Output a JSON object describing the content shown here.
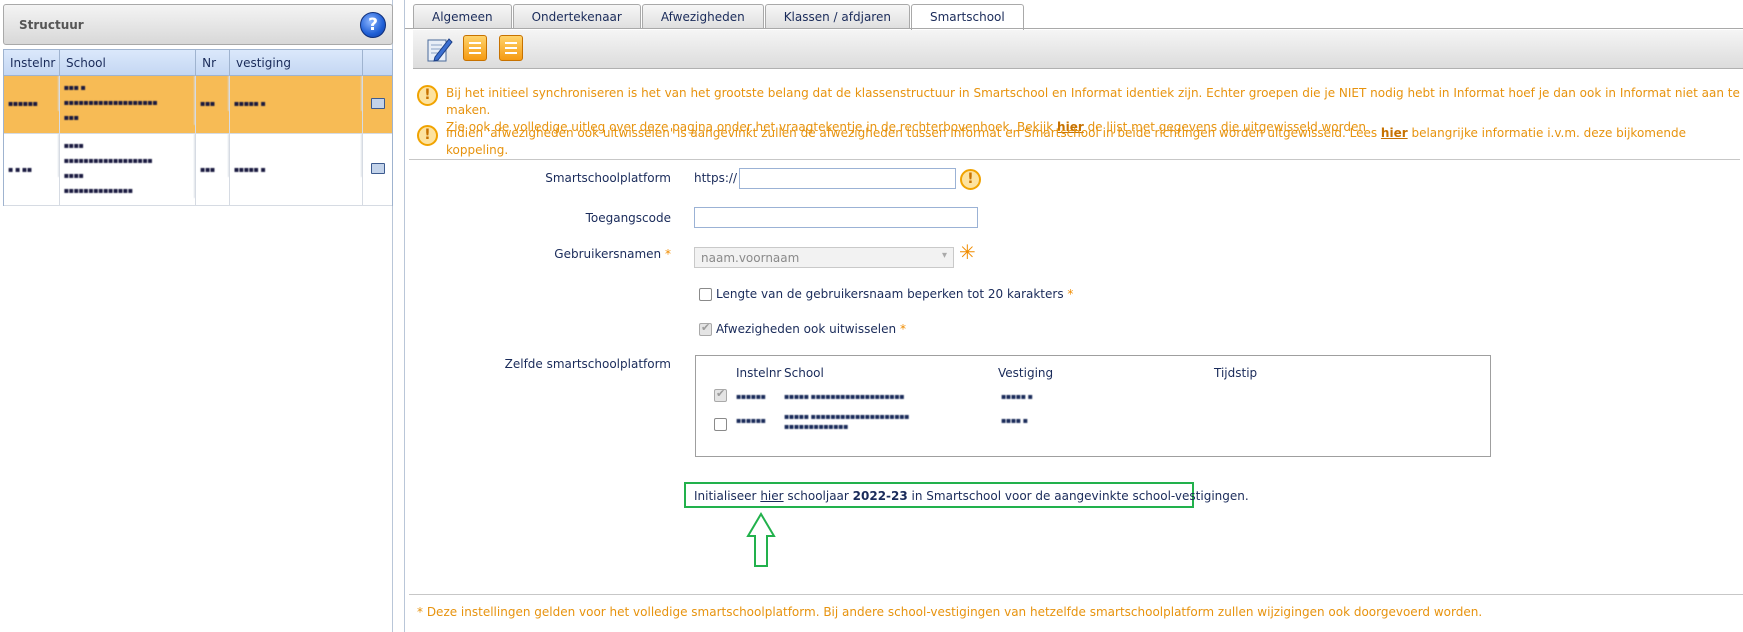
{
  "left_panel": {
    "title": "Structuur",
    "help_icon": "?",
    "columns": [
      "Instelnr",
      "School",
      "Nr",
      "vestiging"
    ],
    "rows": [
      {
        "instelnr": "▪▪▪▪▪▪",
        "school": "▪▪▪ ▪\n▪▪▪▪▪▪▪▪▪▪▪▪▪▪▪▪▪▪▪\n▪▪▪",
        "nr": "▪▪▪",
        "vestiging": "▪▪▪▪▪ ▪",
        "selected": true
      },
      {
        "instelnr": "▪ ▪ ▪▪",
        "school": "▪▪▪▪\n▪▪▪▪▪▪▪▪▪▪▪▪▪▪▪▪▪▪\n▪▪▪▪\n▪▪▪▪▪▪▪▪▪▪▪▪▪▪",
        "nr": "▪▪▪",
        "vestiging": "▪▪▪▪▪ ▪",
        "selected": false
      }
    ]
  },
  "tabs": [
    "Algemeen",
    "Ondertekenaar",
    "Afwezigheden",
    "Klassen / afdjaren",
    "Smartschool"
  ],
  "active_tab": "Smartschool",
  "toolbar": {
    "icons": [
      "edit-icon",
      "list-icon",
      "list-icon"
    ]
  },
  "warnings": {
    "w1_text": "Bij het initieel synchroniseren is het van het grootste belang dat de klassenstructuur in Smartschool en Informat identiek zijn. Echter groepen die je NIET nodig hebt in Informat hoef je dan ook in Informat niet aan te maken.",
    "w1_line2_pre": "Zie ook de volledige uitleg over deze pagina onder het vraagtekentje in de rechterbovenhoek. Bekijk ",
    "w1_link": "hier",
    "w1_line2_post": " de lijst met gegevens die uitgewisseld worden",
    "w2_pre": "Indien 'afwezigheden ook uitwisselen' is aangevinkt zullen de afwezigheden tussen Informat en Smartschool in beide richtingen worden uitgewisseld. Lees ",
    "w2_link": "hier",
    "w2_post": " belangrijke informatie i.v.m. deze bijkomende koppeling."
  },
  "form": {
    "platform_label": "Smartschoolplatform",
    "platform_prefix": "https://",
    "platform_value": "",
    "code_label": "Toegangscode",
    "code_value": "",
    "usernames_label": "Gebruikersnamen",
    "usernames_value": "naam.voornaam",
    "required_mark": "*",
    "limit_label": "Lengte van de gebruikersnaam beperken tot 20 karakters",
    "limit_checked": false,
    "absence_label": "Afwezigheden ook uitwisselen",
    "absence_checked": true,
    "same_platform_label": "Zelfde smartschoolplatform"
  },
  "platform_table": {
    "columns": [
      "Instelnr",
      "School",
      "Vestiging",
      "Tijdstip"
    ],
    "rows": [
      {
        "instelnr": "▪▪▪▪▪▪",
        "school": "▪▪▪▪▪ ▪▪▪▪▪▪▪▪▪▪▪▪▪▪▪▪▪▪▪",
        "vestiging": "▪▪▪▪▪ ▪",
        "tijdstip": "",
        "checked": true
      },
      {
        "instelnr": "▪▪▪▪▪▪",
        "school": "▪▪▪▪▪ ▪▪▪▪▪▪▪▪▪▪▪▪▪▪▪▪▪▪▪▪\n▪▪▪▪▪▪▪▪▪▪▪▪▪",
        "vestiging": "▪▪▪▪ ▪",
        "tijdstip": "",
        "checked": false
      }
    ]
  },
  "init": {
    "pre": "Initialiseer ",
    "link": "hier",
    "mid": " schooljaar ",
    "year": "2022-23",
    "post": " in Smartschool voor de aangevinkte school-vestigingen."
  },
  "footnote": "* Deze instellingen gelden voor het volledige smartschoolplatform. Bij andere school-vestigingen van hetzelfde smartschoolplatform zullen wijzigingen ook doorgevoerd worden.",
  "colors": {
    "accent_orange": "#e7930e",
    "selection": "#f7bb55",
    "highlight_green": "#22b14c"
  }
}
